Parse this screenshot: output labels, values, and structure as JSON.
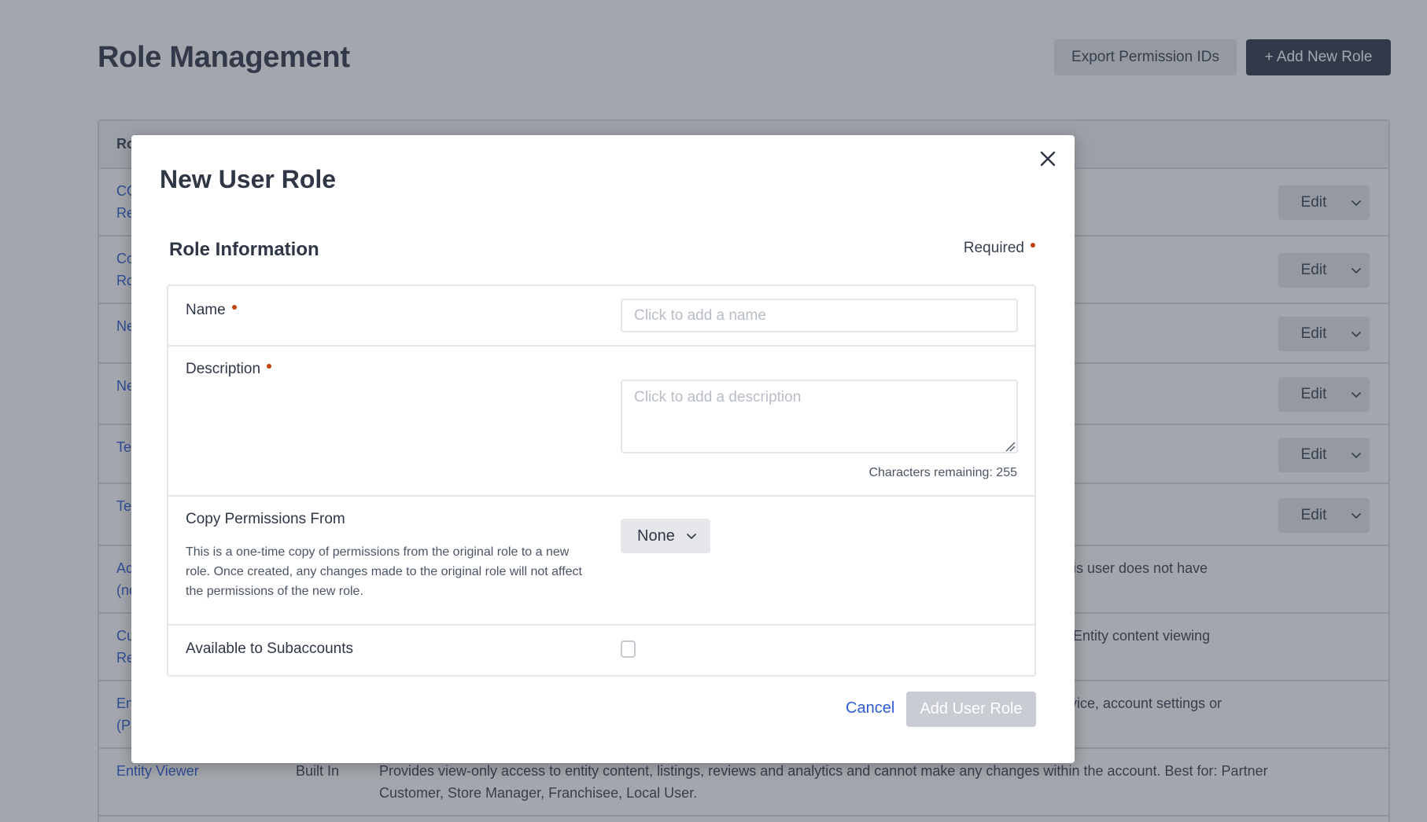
{
  "page": {
    "title": "Role Management",
    "export_button": "Export Permission IDs",
    "add_button": "+ Add New Role"
  },
  "table": {
    "header_first_col": "Role",
    "edit_label": "Edit",
    "rows": [
      {
        "name": "CO\nRe",
        "type": "",
        "desc": "",
        "has_edit": true
      },
      {
        "name": "Co\nRo",
        "type": "",
        "desc": "",
        "has_edit": true
      },
      {
        "name": "Ne",
        "type": "",
        "desc": "",
        "has_edit": true
      },
      {
        "name": "Ne",
        "type": "",
        "desc": "",
        "has_edit": true
      },
      {
        "name": "Te",
        "type": "",
        "desc": "",
        "has_edit": true
      },
      {
        "name": "Te",
        "type": "",
        "desc": "",
        "has_edit": true
      },
      {
        "name": "Ac\n(nc",
        "type": "",
        "desc": "his user does not have",
        "has_edit": false
      },
      {
        "name": "Cu\nRe",
        "type": "",
        "desc": ". Entity content viewing",
        "has_edit": false
      },
      {
        "name": "En\n(Pa",
        "type": "",
        "desc": "rvice, account settings or\nr.",
        "has_edit": false
      },
      {
        "name": "Entity Viewer",
        "type": "Built In",
        "desc": "Provides view-only access to entity content, listings, reviews and analytics and cannot make any changes within the account. Best for: Partner Customer, Store Manager, Franchisee, Local User.",
        "has_edit": false
      }
    ]
  },
  "modal": {
    "title": "New User Role",
    "section_title": "Role Information",
    "required_note": "Required",
    "fields": {
      "name": {
        "label": "Name",
        "placeholder": "Click to add a name",
        "value": "",
        "required": true
      },
      "description": {
        "label": "Description",
        "placeholder": "Click to add a description",
        "value": "",
        "required": true,
        "chars_remaining": "Characters remaining: 255"
      },
      "copy_permissions": {
        "label": "Copy Permissions From",
        "help": "This is a one-time copy of permissions from the original role to a new role. Once created, any changes made to the original role will not affect the permissions of the new role.",
        "selected": "None"
      },
      "subaccounts": {
        "label": "Available to Subaccounts",
        "checked": false
      }
    },
    "cancel_label": "Cancel",
    "submit_label": "Add User Role"
  },
  "colors": {
    "accent_link": "#2c5bd8",
    "primary_dark": "#2f3747",
    "required_dot": "#c2410c",
    "disabled_button": "#c9cdd3"
  }
}
